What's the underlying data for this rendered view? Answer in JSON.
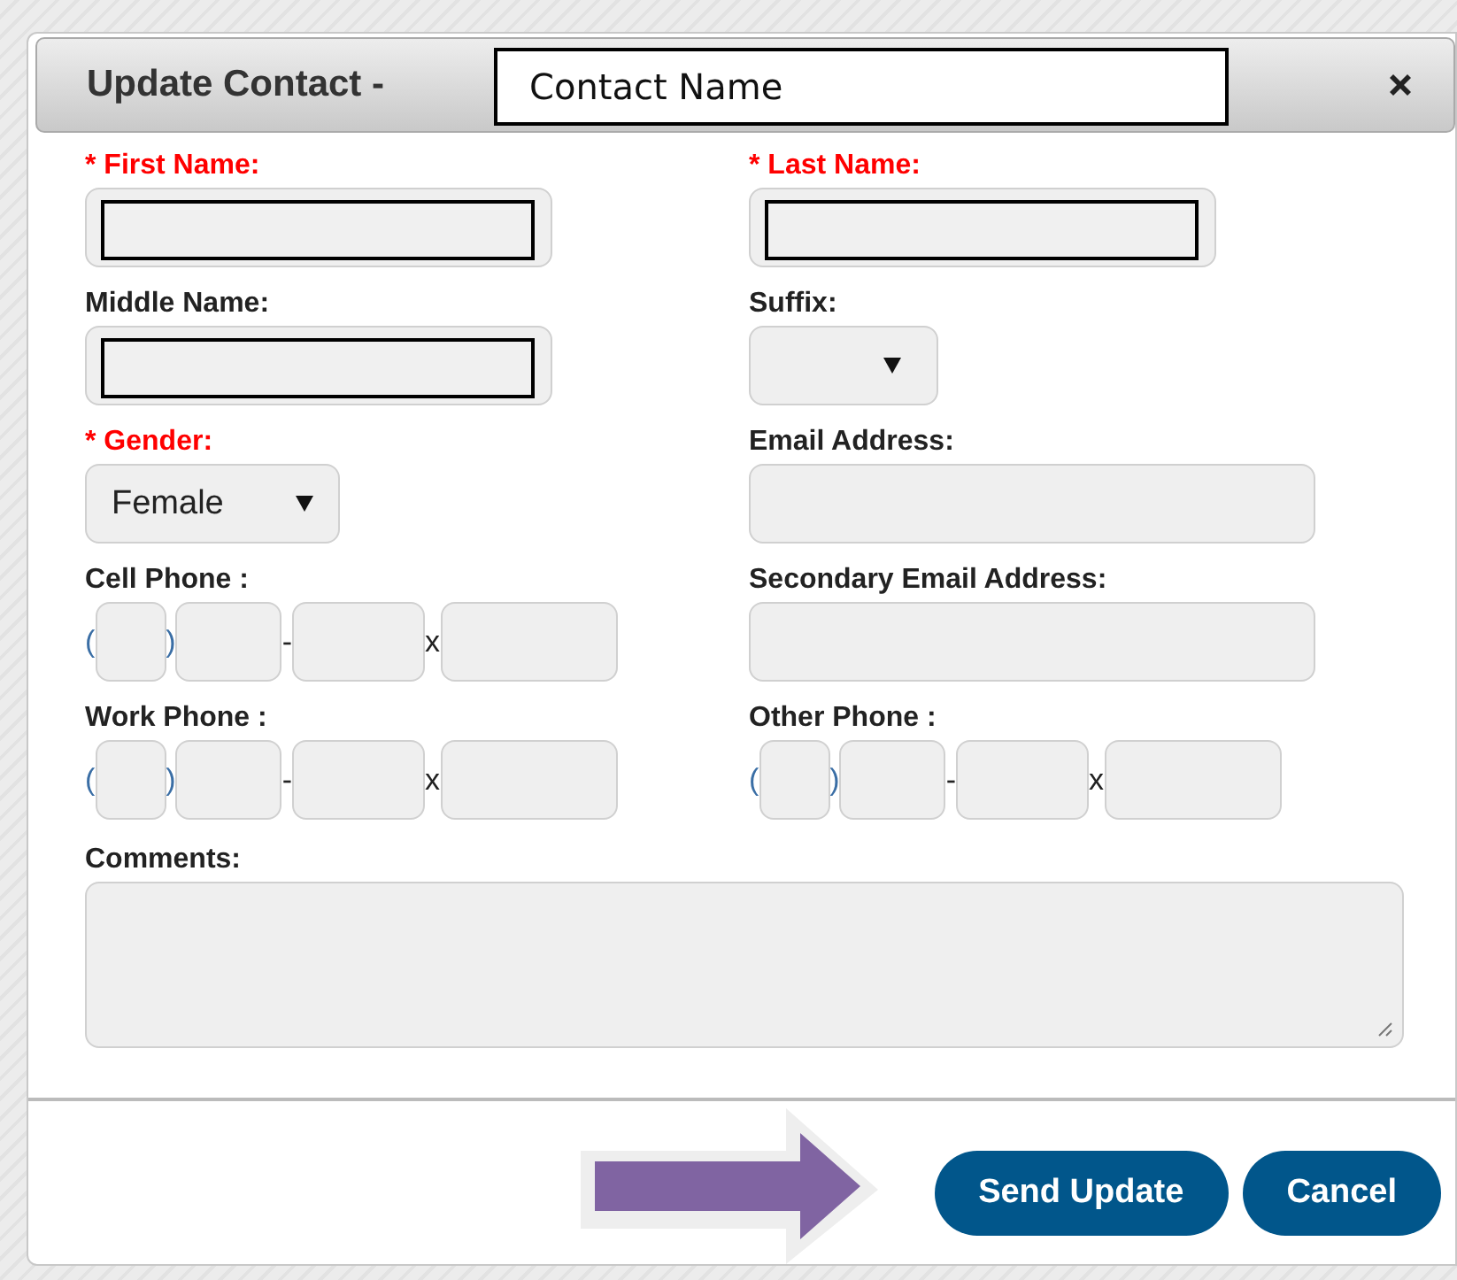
{
  "dialog": {
    "title": "Update Contact -",
    "title_overlay": "Contact Name",
    "fields": [
      {
        "kind": "text",
        "label": "* First Name:",
        "required": true,
        "redacted": true
      },
      {
        "kind": "text",
        "label": "* Last Name:",
        "required": true,
        "redacted": true
      },
      {
        "kind": "text",
        "label": "Middle Name:",
        "required": false,
        "redacted": true
      },
      {
        "kind": "select",
        "label": "Suffix:",
        "required": false
      },
      {
        "kind": "select",
        "label": "* Gender:",
        "required": true,
        "value": "Female"
      },
      {
        "kind": "email",
        "label": "Email Address:",
        "required": false
      },
      {
        "kind": "phone",
        "label": "Cell Phone :",
        "required": false,
        "separators": [
          "(",
          ")",
          "-",
          "x"
        ]
      },
      {
        "kind": "email",
        "label": "Secondary Email Address:",
        "required": false
      },
      {
        "kind": "phone",
        "label": "Work Phone :",
        "required": false,
        "separators": [
          "(",
          ")",
          "-",
          "x"
        ]
      },
      {
        "kind": "phone",
        "label": "Other Phone :",
        "required": false,
        "separators": [
          "(",
          ")",
          "-",
          "x"
        ]
      },
      {
        "kind": "textarea",
        "label": "Comments:",
        "required": false
      }
    ],
    "buttons": [
      "Send Update",
      "Cancel"
    ]
  }
}
